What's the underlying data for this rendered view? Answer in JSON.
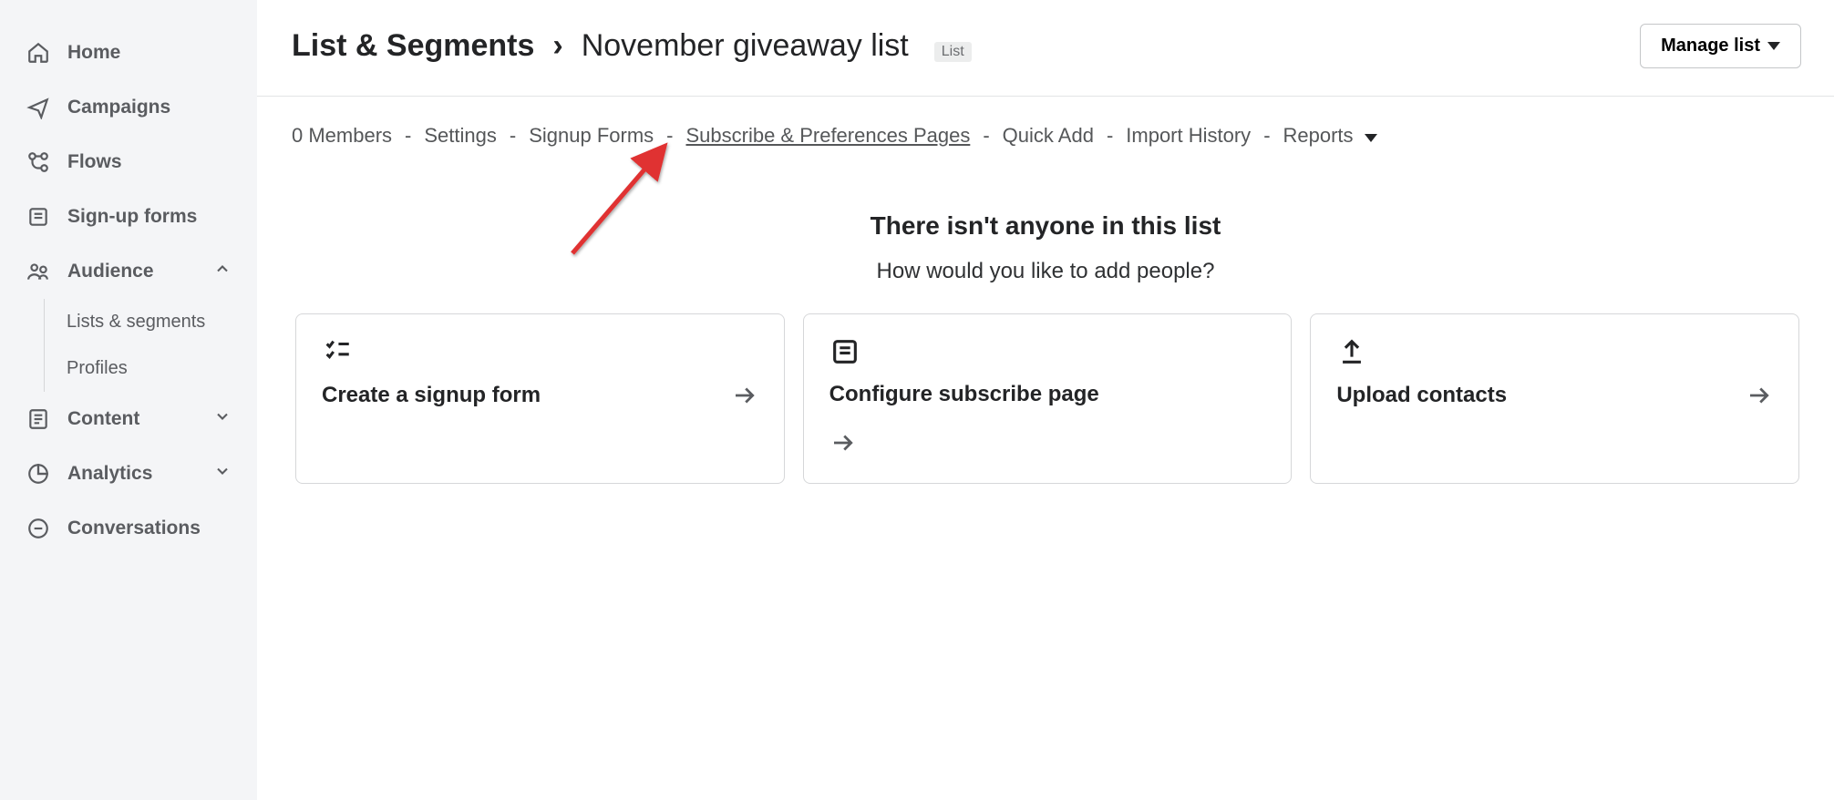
{
  "sidebar": {
    "items": [
      {
        "label": "Home"
      },
      {
        "label": "Campaigns"
      },
      {
        "label": "Flows"
      },
      {
        "label": "Sign-up forms"
      },
      {
        "label": "Audience",
        "expanded": true,
        "children": [
          {
            "label": "Lists & segments"
          },
          {
            "label": "Profiles"
          }
        ]
      },
      {
        "label": "Content"
      },
      {
        "label": "Analytics"
      },
      {
        "label": "Conversations"
      }
    ]
  },
  "header": {
    "breadcrumb_root": "List & Segments",
    "breadcrumb_sep": "›",
    "breadcrumb_leaf": "November giveaway list",
    "badge": "List",
    "manage_button": "Manage list"
  },
  "tabs": {
    "members": "0 Members",
    "settings": "Settings",
    "signup_forms": "Signup Forms",
    "subscribe_pages": "Subscribe & Preferences Pages",
    "quick_add": "Quick Add",
    "import_history": "Import History",
    "reports": "Reports",
    "sep": "-"
  },
  "empty": {
    "title": "There isn't anyone in this list",
    "subtitle": "How would you like to add people?"
  },
  "cards": {
    "create_signup": "Create a signup form",
    "configure_subscribe": "Configure subscribe page",
    "upload_contacts": "Upload contacts"
  }
}
